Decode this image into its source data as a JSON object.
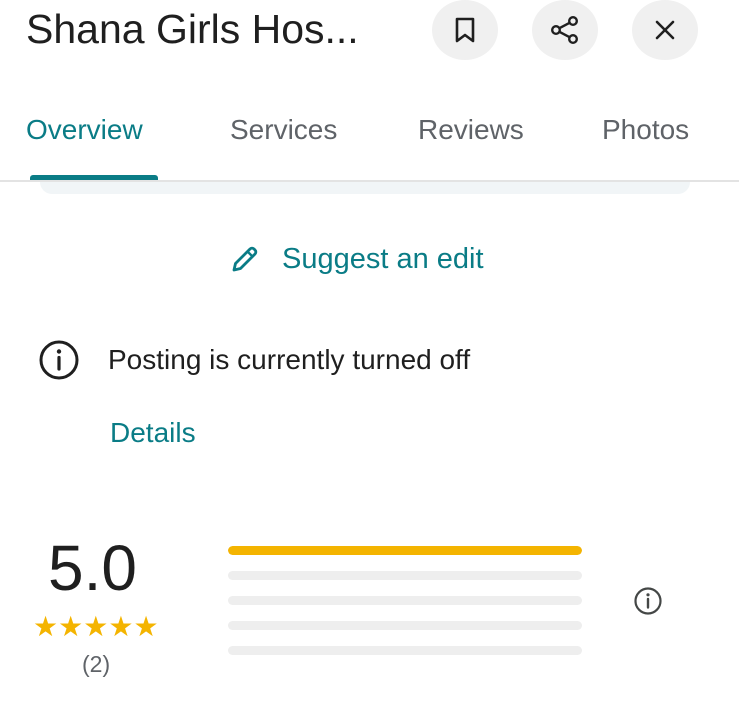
{
  "header": {
    "title": "Shana Girls Hos...",
    "save_icon": "bookmark-icon",
    "share_icon": "share-icon",
    "close_icon": "close-icon"
  },
  "tabs": [
    {
      "label": "Overview",
      "active": true
    },
    {
      "label": "Services",
      "active": false
    },
    {
      "label": "Reviews",
      "active": false
    },
    {
      "label": "Photos",
      "active": false
    }
  ],
  "suggest_edit": {
    "icon": "pencil-icon",
    "label": "Suggest an edit"
  },
  "notice": {
    "icon": "info-icon",
    "text": "Posting is currently turned off",
    "link_label": "Details"
  },
  "rating": {
    "value": "5.0",
    "stars": 5,
    "count_label": "(2)",
    "distribution": [
      {
        "stars": 5,
        "fraction": 1.0
      },
      {
        "stars": 4,
        "fraction": 0
      },
      {
        "stars": 3,
        "fraction": 0
      },
      {
        "stars": 2,
        "fraction": 0
      },
      {
        "stars": 1,
        "fraction": 0
      }
    ],
    "info_icon": "info-icon"
  },
  "colors": {
    "accent": "#0a7c86",
    "star": "#f4b400",
    "text": "#1f1f1f",
    "muted": "#5f6368",
    "button_bg": "#f0f0f0"
  }
}
